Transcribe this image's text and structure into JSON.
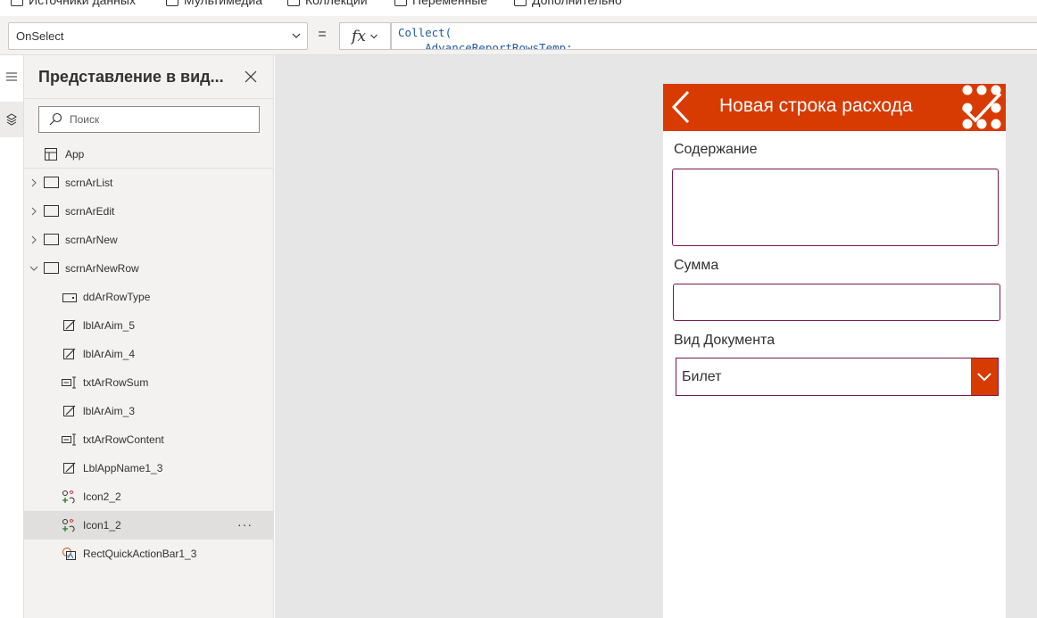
{
  "ribbon": {
    "items": [
      {
        "label": "Источники данных",
        "icon": "data-source-icon"
      },
      {
        "label": "Мультимедиа",
        "icon": "media-icon"
      },
      {
        "label": "Коллекции",
        "icon": "collections-icon"
      },
      {
        "label": "Переменные",
        "icon": "variables-icon"
      },
      {
        "label": "Дополнительно",
        "icon": "advanced-icon"
      }
    ]
  },
  "formula_bar": {
    "property": "OnSelect",
    "equals": "=",
    "fx_label": "fx",
    "formula_line1": "Collect(",
    "formula_line2": "    AdvanceReportRowsTemp;"
  },
  "tree_panel": {
    "title": "Представление в вид...",
    "search_placeholder": "Поиск",
    "app_label": "App",
    "screens": [
      {
        "label": "scrnArList",
        "expanded": false
      },
      {
        "label": "scrnArEdit",
        "expanded": false
      },
      {
        "label": "scrnArNew",
        "expanded": false
      },
      {
        "label": "scrnArNewRow",
        "expanded": true
      }
    ],
    "controls": [
      {
        "label": "ddArRowType",
        "icon": "dropdown-control-icon"
      },
      {
        "label": "lblArAim_5",
        "icon": "label-control-icon"
      },
      {
        "label": "lblArAim_4",
        "icon": "label-control-icon"
      },
      {
        "label": "txtArRowSum",
        "icon": "text-input-control-icon"
      },
      {
        "label": "lblArAim_3",
        "icon": "label-control-icon"
      },
      {
        "label": "txtArRowContent",
        "icon": "text-input-control-icon"
      },
      {
        "label": "LblAppName1_3",
        "icon": "label-control-icon"
      },
      {
        "label": "Icon2_2",
        "icon": "icon-control-icon"
      },
      {
        "label": "Icon1_2",
        "icon": "icon-control-icon",
        "selected": true
      },
      {
        "label": "RectQuickActionBar1_3",
        "icon": "shape-control-icon"
      }
    ],
    "more_label": "···"
  },
  "app_screen": {
    "header_title": "Новая строка расхода",
    "colors": {
      "accent": "#d83b01",
      "border": "#7a1750",
      "canvas": "#e6e6e6"
    },
    "content_label": "Содержание",
    "content_value": "",
    "sum_label": "Сумма",
    "sum_value": "",
    "doc_type_label": "Вид Документа",
    "doc_type_value": "Билет"
  }
}
